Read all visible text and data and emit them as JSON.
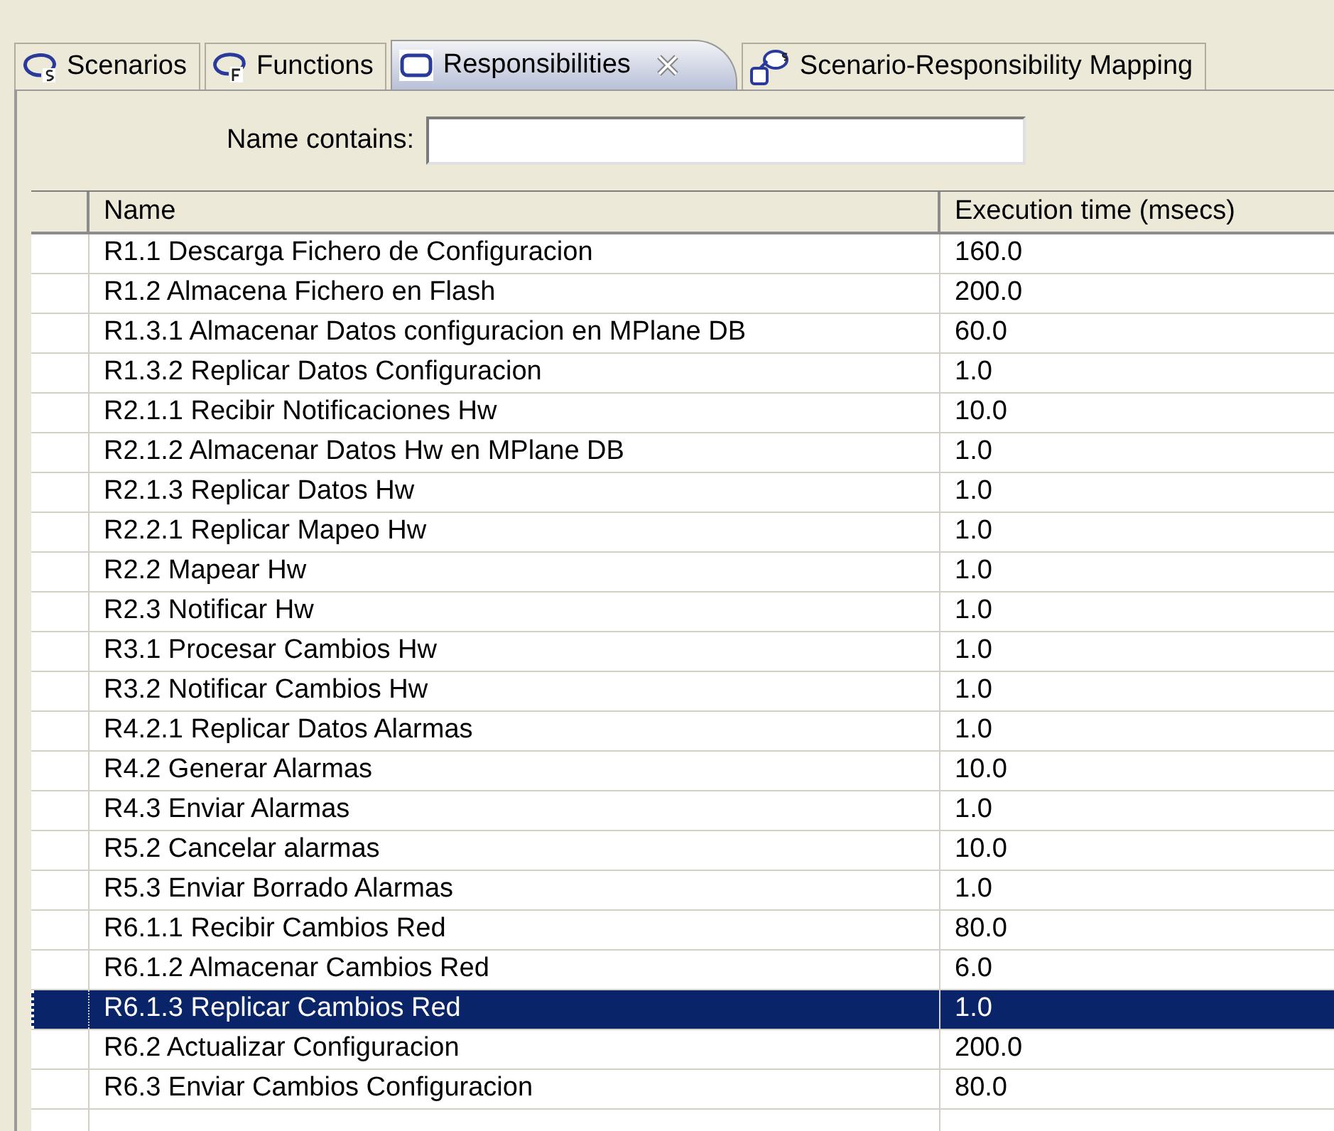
{
  "tabs": [
    {
      "label": "Scenarios",
      "kind": "scenario",
      "selected": false,
      "closable": false
    },
    {
      "label": "Functions",
      "kind": "function",
      "selected": false,
      "closable": false
    },
    {
      "label": "Responsibilities",
      "kind": "responsibility",
      "selected": true,
      "closable": true
    },
    {
      "label": "Scenario-Responsibility Mapping",
      "kind": "mapping",
      "selected": false,
      "closable": false
    }
  ],
  "filter": {
    "label": "Name contains:"
  },
  "table": {
    "columns": [
      "Name",
      "Execution time (msecs)"
    ],
    "rows": [
      {
        "name": "R1.1 Descarga Fichero de Configuracion",
        "time": "160.0",
        "selected": false
      },
      {
        "name": "R1.2 Almacena Fichero en Flash",
        "time": "200.0",
        "selected": false
      },
      {
        "name": "R1.3.1 Almacenar Datos configuracion en MPlane DB",
        "time": "60.0",
        "selected": false
      },
      {
        "name": "R1.3.2 Replicar Datos Configuracion",
        "time": "1.0",
        "selected": false
      },
      {
        "name": "R2.1.1 Recibir Notificaciones Hw",
        "time": "10.0",
        "selected": false
      },
      {
        "name": "R2.1.2 Almacenar Datos Hw en MPlane DB",
        "time": "1.0",
        "selected": false
      },
      {
        "name": "R2.1.3 Replicar Datos Hw",
        "time": "1.0",
        "selected": false
      },
      {
        "name": "R2.2.1 Replicar Mapeo Hw",
        "time": "1.0",
        "selected": false
      },
      {
        "name": "R2.2 Mapear Hw",
        "time": "1.0",
        "selected": false
      },
      {
        "name": "R2.3 Notificar Hw",
        "time": "1.0",
        "selected": false
      },
      {
        "name": "R3.1 Procesar Cambios Hw",
        "time": "1.0",
        "selected": false
      },
      {
        "name": "R3.2 Notificar Cambios Hw",
        "time": "1.0",
        "selected": false
      },
      {
        "name": "R4.2.1 Replicar Datos Alarmas",
        "time": "1.0",
        "selected": false
      },
      {
        "name": "R4.2 Generar Alarmas",
        "time": "10.0",
        "selected": false
      },
      {
        "name": "R4.3 Enviar Alarmas",
        "time": "1.0",
        "selected": false
      },
      {
        "name": "R5.2 Cancelar alarmas",
        "time": "10.0",
        "selected": false
      },
      {
        "name": "R5.3 Enviar Borrado Alarmas",
        "time": "1.0",
        "selected": false
      },
      {
        "name": "R6.1.1 Recibir Cambios Red",
        "time": "80.0",
        "selected": false
      },
      {
        "name": "R6.1.2 Almacenar Cambios Red",
        "time": "6.0",
        "selected": false
      },
      {
        "name": "R6.1.3 Replicar Cambios Red",
        "time": "1.0",
        "selected": true
      },
      {
        "name": "R6.2 Actualizar Configuracion",
        "time": "200.0",
        "selected": false
      },
      {
        "name": "R6.3 Enviar Cambios Configuracion",
        "time": "80.0",
        "selected": false
      }
    ]
  }
}
